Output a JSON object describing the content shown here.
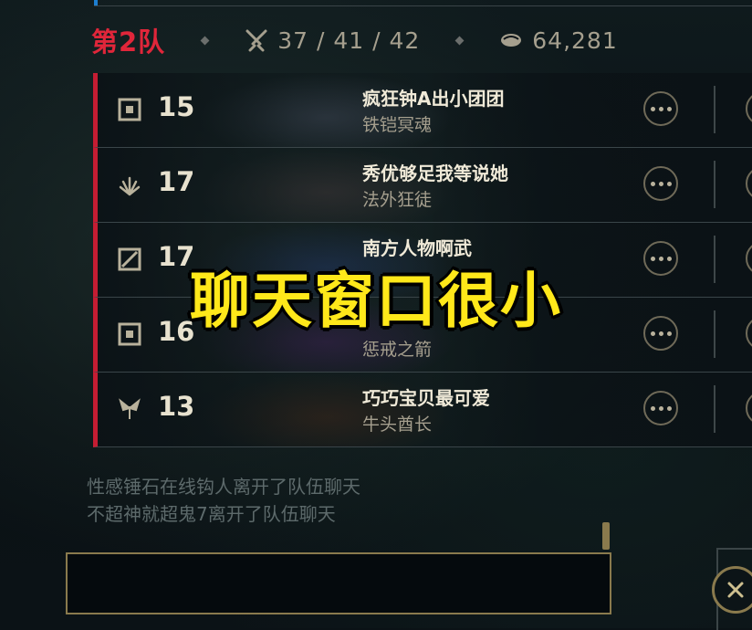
{
  "team": {
    "label": "第2队",
    "kda": "37 / 41 / 42",
    "gold": "64,281"
  },
  "players": [
    {
      "level": "15",
      "name": "疯狂钟A出小团团",
      "champion": "铁铠冥魂",
      "rank_icon": "rank-square-icon",
      "portrait_color": "#3c4652"
    },
    {
      "level": "17",
      "name": "秀优够足我等说她",
      "champion": "法外狂徒",
      "rank_icon": "rank-claw-icon",
      "portrait_color": "#3d3a3a"
    },
    {
      "level": "17",
      "name": "南方人物啊武",
      "champion": "",
      "rank_icon": "rank-slash-icon",
      "portrait_color": "#243a5e"
    },
    {
      "level": "16",
      "name": "",
      "champion": "惩戒之箭",
      "rank_icon": "rank-square-icon",
      "portrait_color": "#3a2750"
    },
    {
      "level": "13",
      "name": "巧巧宝贝最可爱",
      "champion": "牛头酋长",
      "rank_icon": "rank-wing-icon",
      "portrait_color": "#3a2a1e"
    }
  ],
  "chat": {
    "lines": [
      "性感锤石在线钩人离开了队伍聊天",
      "不超神就超鬼7离开了队伍聊天"
    ],
    "input_value": ""
  },
  "overlay_caption": "聊天窗口很小",
  "colors": {
    "team_red": "#e0263a",
    "gold_border": "#8a7a4d",
    "caption_yellow": "#ffe81a"
  }
}
